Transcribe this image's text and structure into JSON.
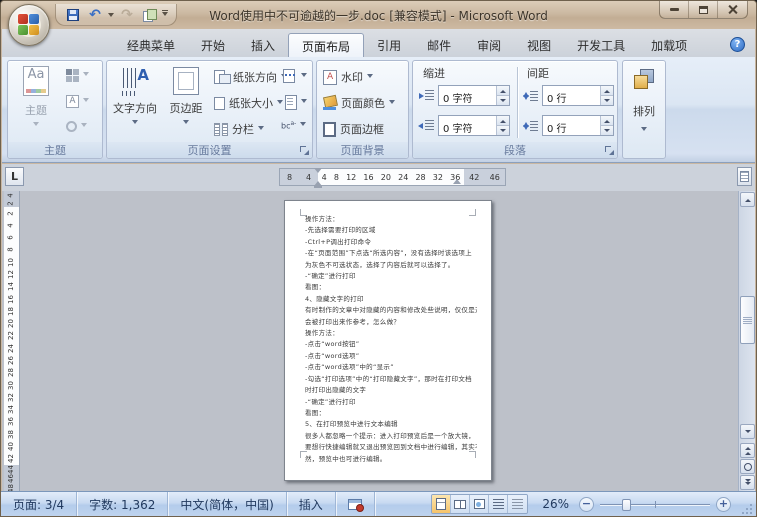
{
  "window": {
    "title": "Word使用中不可逾越的一步.doc [兼容模式] - Microsoft Word"
  },
  "help_glyph": "?",
  "icon_names": [
    "office-button",
    "save-icon",
    "undo-icon",
    "redo-icon",
    "copy-icon",
    "qat-customize-icon",
    "minimize-icon",
    "restore-icon",
    "close-icon",
    "help-icon",
    "macro-record-icon",
    "print-layout-view-icon",
    "full-screen-reading-view-icon",
    "web-layout-view-icon",
    "outline-view-icon",
    "draft-view-icon",
    "ruler-toggle-icon"
  ],
  "tabs": [
    {
      "label": "经典菜单",
      "cls": ""
    },
    {
      "label": "开始",
      "cls": ""
    },
    {
      "label": "插入",
      "cls": ""
    },
    {
      "label": "页面布局",
      "cls": "active"
    },
    {
      "label": "引用",
      "cls": ""
    },
    {
      "label": "邮件",
      "cls": ""
    },
    {
      "label": "审阅",
      "cls": ""
    },
    {
      "label": "视图",
      "cls": ""
    },
    {
      "label": "开发工具",
      "cls": ""
    },
    {
      "label": "加载项",
      "cls": ""
    }
  ],
  "ribbon": {
    "themes": {
      "group_label": "主题",
      "themes_button": "主题"
    },
    "page_setup": {
      "group_label": "页面设置",
      "text_direction": "文字方向",
      "margins": "页边距",
      "orientation": "纸张方向",
      "paper_size": "纸张大小",
      "columns": "分栏",
      "hyphenation_abbr": "bc",
      "hyphenation_sup": "a-"
    },
    "page_background": {
      "group_label": "页面背景",
      "watermark": "水印",
      "page_color": "页面颜色",
      "page_borders": "页面边框"
    },
    "paragraph": {
      "group_label": "段落",
      "indent_label": "缩进",
      "spacing_label": "间距",
      "indent_left": "0 字符",
      "indent_right": "0 字符",
      "space_before": "0 行",
      "space_after": "0 行"
    },
    "arrange": {
      "button_label": "排列"
    }
  },
  "ruler": {
    "tab_selector": "L",
    "h_outside_left": [
      "8",
      "4"
    ],
    "h_inside": [
      "4",
      "8",
      "12",
      "16",
      "20",
      "24",
      "28",
      "32",
      "36"
    ],
    "h_outside_right": [
      "42",
      "46"
    ],
    "v_outside_top": [
      "4",
      "2"
    ],
    "v_inside": [
      "2",
      "4",
      "6",
      "8",
      "10",
      "12",
      "14",
      "16",
      "18",
      "20",
      "22",
      "24",
      "26",
      "28",
      "30",
      "32",
      "34",
      "36",
      "38",
      "40",
      "42"
    ],
    "v_outside_bottom": [
      "44",
      "46",
      "48"
    ]
  },
  "document": {
    "lines": [
      "操作方法：",
      "-先选择需要打印的区域",
      "-Ctrl+P调出打印命令",
      "-在“页面范围”下点选“所选内容”，没有选择时该选项上",
      "为灰色不可选状态，选择了内容后就可以选择了。",
      "-“确定”进行打印",
      "看图：",
      "4、隐藏文字的打印",
      "有时制作的文章中对隐藏的内容和修改处些说明，仅仅是对文（需要",
      "会被打印出来作参考，怎么做？",
      "操作方法：",
      "-点击“word按钮”",
      "-点击“word选项”",
      "-点击“word选项”中的“显示”",
      "-勾选“打印选项”中的“打印隐藏文字”，那时在打印文档",
      "时打印出隐藏的文字",
      "-“确定”进行打印",
      "看图：",
      "5、在打印预览中进行文本编辑",
      "很多人都忽略一个提示：进入打印预览后是一个放大镜，",
      "要想行快捷编辑就又退出预览回到文档中进行编辑，其实不",
      "然，预览中也可进行编辑。"
    ]
  },
  "status": {
    "page": "页面: 3/4",
    "words": "字数: 1,362",
    "language": "中文(简体，中国)",
    "insert_mode": "插入",
    "zoom_level": "26%"
  },
  "colors": {
    "accent_blue": "#2b579a",
    "glass_tan": "#c9b7a2",
    "ribbon_bg": "#dde8f5",
    "canvas_gray": "#bdc1c9",
    "status_blue": "#bcd2ee",
    "active_view_amber": "#f5c36a"
  }
}
